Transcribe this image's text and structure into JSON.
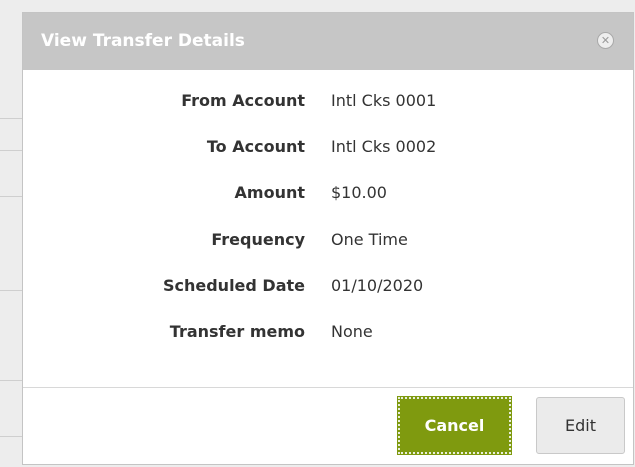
{
  "dialog": {
    "title": "View Transfer Details",
    "close_icon": "close-circle-icon"
  },
  "details": [
    {
      "label": "From Account",
      "value": "Intl Cks 0001"
    },
    {
      "label": "To Account",
      "value": "Intl Cks 0002"
    },
    {
      "label": "Amount",
      "value": "$10.00"
    },
    {
      "label": "Frequency",
      "value": "One Time"
    },
    {
      "label": "Scheduled Date",
      "value": "01/10/2020"
    },
    {
      "label": "Transfer memo",
      "value": "None"
    }
  ],
  "buttons": {
    "cancel_label": "Cancel",
    "edit_label": "Edit"
  },
  "colors": {
    "header_bg": "#c6c6c6",
    "primary_button": "#7f9a0f",
    "secondary_button": "#ebebeb"
  }
}
